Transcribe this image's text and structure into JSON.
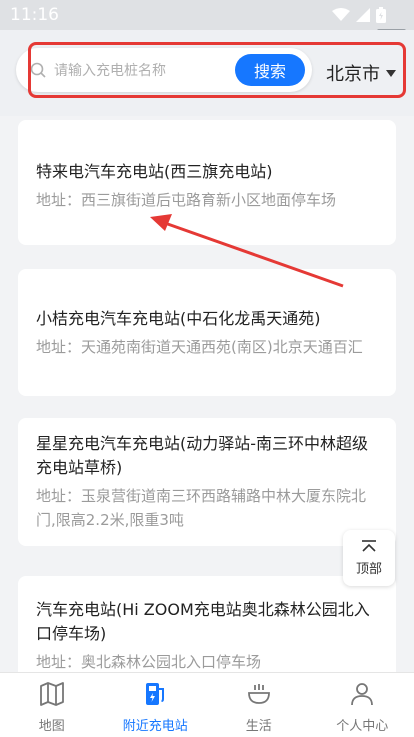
{
  "status": {
    "time": "11:16",
    "tag": "cusn"
  },
  "search": {
    "placeholder": "请输入充电桩名称",
    "button": "搜索"
  },
  "city": {
    "label": "北京市"
  },
  "stations": [
    {
      "title": "特来电汽车充电站(西三旗充电站)",
      "address": "地址：西三旗街道后屯路育新小区地面停车场"
    },
    {
      "title": "小桔充电汽车充电站(中石化龙禹天通苑)",
      "address": "地址：天通苑南街道天通西苑(南区)北京天通百汇"
    },
    {
      "title": "星星充电汽车充电站(动力驿站-南三环中林超级充电站草桥)",
      "address": "地址：玉泉营街道南三环西路辅路中林大厦东院北门,限高2.2米,限重3吨"
    },
    {
      "title": "汽车充电站(Hi ZOOM充电站奥北森林公园北入口停车场)",
      "address": "地址：奥北森林公园北入口停车场"
    }
  ],
  "to_top": {
    "label": "顶部"
  },
  "tabs": [
    {
      "label": "地图",
      "icon": "map-icon"
    },
    {
      "label": "附近充电站",
      "icon": "charging-station-icon",
      "active": true
    },
    {
      "label": "生活",
      "icon": "bowl-icon"
    },
    {
      "label": "个人中心",
      "icon": "person-icon"
    }
  ],
  "colors": {
    "accent": "#1677ff",
    "annotation": "#e53935"
  }
}
